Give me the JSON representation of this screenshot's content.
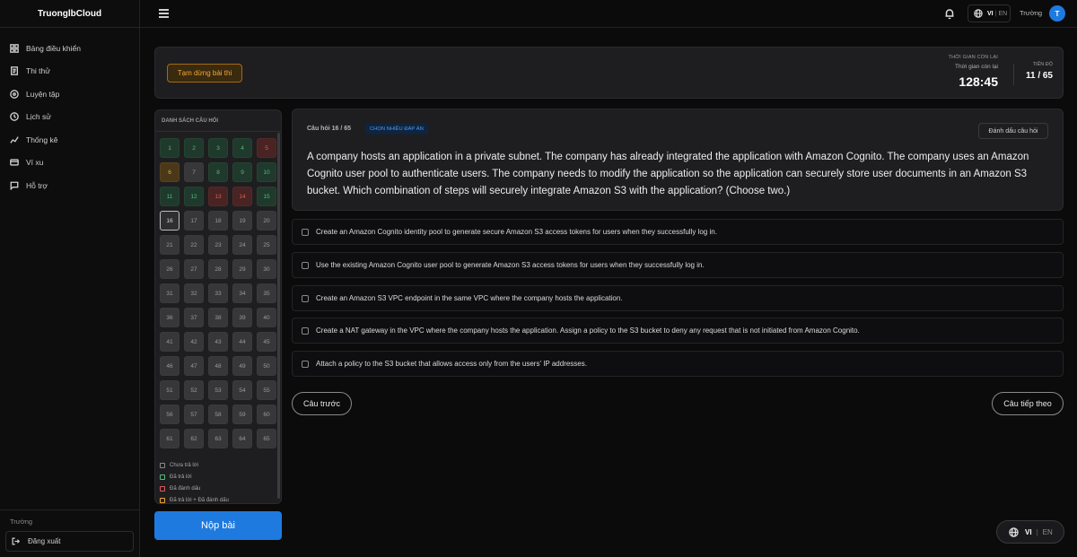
{
  "brand": "TruonglbCloud",
  "sidebar": {
    "items": [
      {
        "label": "Bảng điều khiển",
        "icon": "dashboard-icon"
      },
      {
        "label": "Thi thử",
        "icon": "document-icon"
      },
      {
        "label": "Luyện tập",
        "icon": "target-icon"
      },
      {
        "label": "Lịch sử",
        "icon": "clock-icon"
      },
      {
        "label": "Thống kê",
        "icon": "chart-icon"
      },
      {
        "label": "Ví xu",
        "icon": "wallet-icon"
      },
      {
        "label": "Hỗ trợ",
        "icon": "chat-icon"
      }
    ],
    "user_name": "Trường",
    "logout_label": "Đăng xuất"
  },
  "header": {
    "lang_vi": "VI",
    "lang_sep": "|",
    "lang_en": "EN",
    "user_name": "Trường",
    "avatar_initial": "T"
  },
  "exam": {
    "pause_label": "Tạm dừng bài thi",
    "timer_title": "THỜI GIAN CÒN LẠI",
    "timer_sub": "Thời gian còn lại",
    "timer_value": "128:45",
    "progress_title": "TIẾN ĐỘ",
    "progress_value": "11 / 65"
  },
  "question_list": {
    "title": "DANH SÁCH CÂU HỎI",
    "current": 16,
    "cells": [
      {
        "n": "1",
        "s": "answered"
      },
      {
        "n": "2",
        "s": "answered"
      },
      {
        "n": "3",
        "s": "answered"
      },
      {
        "n": "4",
        "s": "answered"
      },
      {
        "n": "5",
        "s": "marked"
      },
      {
        "n": "6",
        "s": "both"
      },
      {
        "n": "7",
        "s": "unanswered"
      },
      {
        "n": "8",
        "s": "answered"
      },
      {
        "n": "9",
        "s": "answered"
      },
      {
        "n": "10",
        "s": "answered"
      },
      {
        "n": "11",
        "s": "answered"
      },
      {
        "n": "12",
        "s": "answered"
      },
      {
        "n": "13",
        "s": "marked"
      },
      {
        "n": "14",
        "s": "marked"
      },
      {
        "n": "15",
        "s": "answered"
      },
      {
        "n": "16",
        "s": "current"
      },
      {
        "n": "17",
        "s": "unanswered"
      },
      {
        "n": "18",
        "s": "unanswered"
      },
      {
        "n": "19",
        "s": "unanswered"
      },
      {
        "n": "20",
        "s": "unanswered"
      },
      {
        "n": "21",
        "s": "unanswered"
      },
      {
        "n": "22",
        "s": "unanswered"
      },
      {
        "n": "23",
        "s": "unanswered"
      },
      {
        "n": "24",
        "s": "unanswered"
      },
      {
        "n": "25",
        "s": "unanswered"
      },
      {
        "n": "26",
        "s": "unanswered"
      },
      {
        "n": "27",
        "s": "unanswered"
      },
      {
        "n": "28",
        "s": "unanswered"
      },
      {
        "n": "29",
        "s": "unanswered"
      },
      {
        "n": "30",
        "s": "unanswered"
      },
      {
        "n": "31",
        "s": "unanswered"
      },
      {
        "n": "32",
        "s": "unanswered"
      },
      {
        "n": "33",
        "s": "unanswered"
      },
      {
        "n": "34",
        "s": "unanswered"
      },
      {
        "n": "35",
        "s": "unanswered"
      },
      {
        "n": "36",
        "s": "unanswered"
      },
      {
        "n": "37",
        "s": "unanswered"
      },
      {
        "n": "38",
        "s": "unanswered"
      },
      {
        "n": "39",
        "s": "unanswered"
      },
      {
        "n": "40",
        "s": "unanswered"
      },
      {
        "n": "41",
        "s": "unanswered"
      },
      {
        "n": "42",
        "s": "unanswered"
      },
      {
        "n": "43",
        "s": "unanswered"
      },
      {
        "n": "44",
        "s": "unanswered"
      },
      {
        "n": "45",
        "s": "unanswered"
      },
      {
        "n": "46",
        "s": "unanswered"
      },
      {
        "n": "47",
        "s": "unanswered"
      },
      {
        "n": "48",
        "s": "unanswered"
      },
      {
        "n": "49",
        "s": "unanswered"
      },
      {
        "n": "50",
        "s": "unanswered"
      },
      {
        "n": "51",
        "s": "unanswered"
      },
      {
        "n": "52",
        "s": "unanswered"
      },
      {
        "n": "53",
        "s": "unanswered"
      },
      {
        "n": "54",
        "s": "unanswered"
      },
      {
        "n": "55",
        "s": "unanswered"
      },
      {
        "n": "56",
        "s": "unanswered"
      },
      {
        "n": "57",
        "s": "unanswered"
      },
      {
        "n": "58",
        "s": "unanswered"
      },
      {
        "n": "59",
        "s": "unanswered"
      },
      {
        "n": "60",
        "s": "unanswered"
      },
      {
        "n": "61",
        "s": "unanswered"
      },
      {
        "n": "62",
        "s": "unanswered"
      },
      {
        "n": "63",
        "s": "unanswered"
      },
      {
        "n": "64",
        "s": "unanswered"
      },
      {
        "n": "65",
        "s": "unanswered"
      }
    ],
    "legend": [
      {
        "label": "Chưa trả lời",
        "key": "un"
      },
      {
        "label": "Đã trả lời",
        "key": "ans"
      },
      {
        "label": "Đã đánh dấu",
        "key": "mark"
      },
      {
        "label": "Đã trả lời + Đã đánh dấu",
        "key": "both"
      }
    ]
  },
  "submit_label": "Nộp bài",
  "question": {
    "number_label": "Câu hỏi 16 / 65",
    "type_badge": "CHỌN NHIỀU ĐÁP ÁN",
    "mark_label": "Đánh dấu câu hỏi",
    "text": "A company hosts an application in a private subnet. The company has already integrated the application with Amazon Cognito. The company uses an Amazon Cognito user pool to authenticate users. The company needs to modify the application so the application can securely store user documents in an Amazon S3 bucket. Which combination of steps will securely integrate Amazon S3 with the application? (Choose two.)",
    "options": [
      "Create an Amazon Cognito identity pool to generate secure Amazon S3 access tokens for users when they successfully log in.",
      "Use the existing Amazon Cognito user pool to generate Amazon S3 access tokens for users when they successfully log in.",
      "Create an Amazon S3 VPC endpoint in the same VPC where the company hosts the application.",
      "Create a NAT gateway in the VPC where the company hosts the application. Assign a policy to the S3 bucket to deny any request that is not initiated from Amazon Cognito.",
      "Attach a policy to the S3 bucket that allows access only from the users' IP addresses."
    ]
  },
  "nav": {
    "prev_label": "Câu trước",
    "next_label": "Câu tiếp theo"
  },
  "lang_float": {
    "vi": "VI",
    "sep": "|",
    "en": "EN"
  },
  "colors": {
    "accent": "#1f7ae0",
    "answered": "#4dbd7a",
    "marked": "#e05a5a",
    "both": "#f0a83a",
    "background": "#0b0b0c",
    "panel": "#1e1e20"
  }
}
